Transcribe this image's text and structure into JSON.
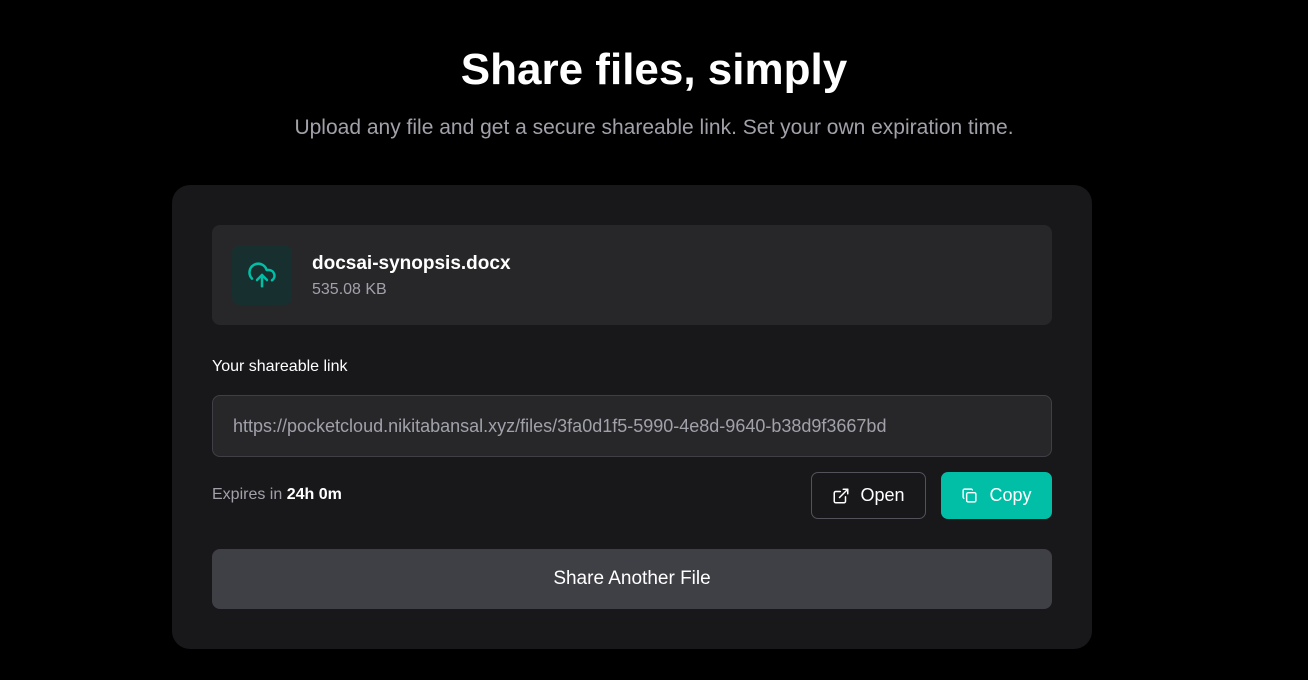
{
  "hero": {
    "title": "Share files, simply",
    "subtitle": "Upload any file and get a secure shareable link. Set your own expiration time."
  },
  "file": {
    "icon": "cloud-upload-icon",
    "name": "docsai-synopsis.docx",
    "size": "535.08 KB"
  },
  "link": {
    "label": "Your shareable link",
    "url": "https://pocketcloud.nikitabansal.xyz/files/3fa0d1f5-5990-4e8d-9640-b38d9f3667bd"
  },
  "expires": {
    "prefix": "Expires in",
    "value": "24h 0m"
  },
  "actions": {
    "open_label": "Open",
    "open_icon": "external-link-icon",
    "copy_label": "Copy",
    "copy_icon": "copy-icon",
    "share_another_label": "Share Another File"
  },
  "colors": {
    "background": "#000000",
    "card": "#18181b",
    "surface": "#27272a",
    "accent": "#00bfa6",
    "muted_text": "#a1a1aa"
  }
}
